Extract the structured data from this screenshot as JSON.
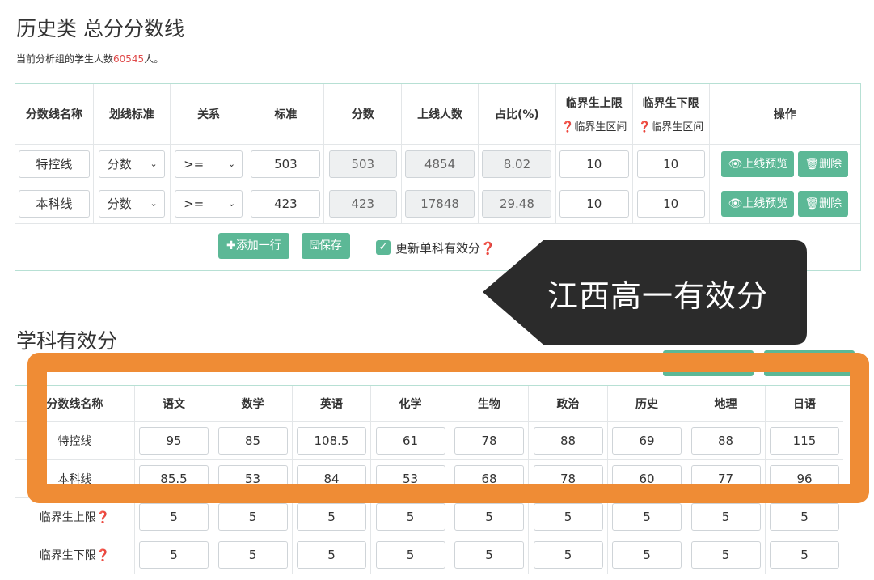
{
  "header": {
    "title": "历史类 总分分数线",
    "subtitle_prefix": "当前分析组的学生人数",
    "student_count": "60545",
    "subtitle_suffix": "人。"
  },
  "score_table": {
    "headers": {
      "name": "分数线名称",
      "standard_type": "划线标准",
      "relation": "关系",
      "standard": "标准",
      "score": "分数",
      "count": "上线人数",
      "ratio": "占比(%)",
      "upper": "临界生上限",
      "upper_sub": "❓临界生区间",
      "lower": "临界生下限",
      "lower_sub": "❓临界生区间",
      "action": "操作"
    },
    "rows": [
      {
        "name": "特控线",
        "standard_type": "分数",
        "relation": ">=",
        "standard": "503",
        "score": "503",
        "count": "4854",
        "ratio": "8.02",
        "upper": "10",
        "lower": "10",
        "preview": "👁上线预览",
        "delete": "🗑删除"
      },
      {
        "name": "本科线",
        "standard_type": "分数",
        "relation": ">=",
        "standard": "423",
        "score": "423",
        "count": "17848",
        "ratio": "29.48",
        "upper": "10",
        "lower": "10",
        "preview": "👁上线预览",
        "delete": "🗑删除"
      }
    ],
    "add_row_label": "✚添加一行",
    "save_label": "🖫保存",
    "update_label": "更新单科有效分❓"
  },
  "callout": {
    "text": "江西高一有效分"
  },
  "subject_section": {
    "title": "学科有效分",
    "headers": [
      "分数线名称",
      "语文",
      "数学",
      "英语",
      "化学",
      "生物",
      "政治",
      "历史",
      "地理",
      "日语"
    ],
    "rows": [
      {
        "label": "特控线",
        "values": [
          "95",
          "85",
          "108.5",
          "61",
          "78",
          "88",
          "69",
          "88",
          "115"
        ]
      },
      {
        "label": "本科线",
        "values": [
          "85.5",
          "53",
          "84",
          "53",
          "68",
          "78",
          "60",
          "77",
          "96"
        ]
      },
      {
        "label": "临界生上限❓",
        "values": [
          "5",
          "5",
          "5",
          "5",
          "5",
          "5",
          "5",
          "5",
          "5"
        ]
      },
      {
        "label": "临界生下限❓",
        "values": [
          "5",
          "5",
          "5",
          "5",
          "5",
          "5",
          "5",
          "5",
          "5"
        ]
      }
    ]
  },
  "colors": {
    "accent": "#5cb896",
    "highlight": "#ef8c35",
    "callout_bg": "#2b2b2b",
    "count_red": "#e04b4b"
  }
}
